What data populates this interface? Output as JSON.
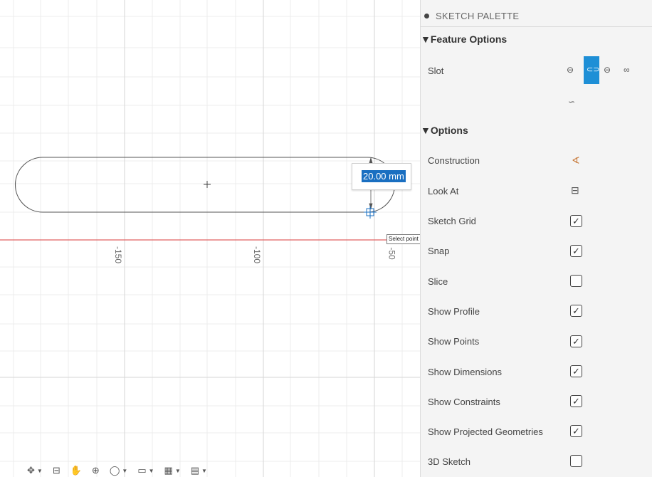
{
  "canvas": {
    "dimension_value": "20.00 mm",
    "tooltip": "Select point on slot",
    "axis_ticks": [
      "-150",
      "-100",
      "-50"
    ]
  },
  "palette": {
    "title": "SKETCH PALETTE",
    "feature_options_label": "▼Feature Options",
    "slot_label": "Slot",
    "options_label": "▼Options",
    "rows": [
      {
        "label": "Construction",
        "control": "construction-icon"
      },
      {
        "label": "Look At",
        "control": "look-at-icon"
      },
      {
        "label": "Sketch Grid",
        "checked": true
      },
      {
        "label": "Snap",
        "checked": true
      },
      {
        "label": "Slice",
        "checked": false
      },
      {
        "label": "Show Profile",
        "checked": true
      },
      {
        "label": "Show Points",
        "checked": true
      },
      {
        "label": "Show Dimensions",
        "checked": true
      },
      {
        "label": "Show Constraints",
        "checked": true
      },
      {
        "label": "Show Projected Geometries",
        "checked": true
      },
      {
        "label": "3D Sketch",
        "checked": false
      }
    ],
    "slot_types": [
      "center-to-center-slot-icon",
      "overall-slot-icon",
      "center-point-slot-icon",
      "three-point-arc-slot-icon",
      "center-point-arc-slot-icon"
    ],
    "selected_slot_type_index": 1,
    "accent_color": "#1e8fd6"
  },
  "toolbar": {
    "icons": [
      "orbit-icon",
      "look-at-icon",
      "pan-icon",
      "zoom-icon",
      "fit-icon",
      "display-settings-icon",
      "grid-settings-icon",
      "viewports-icon"
    ]
  },
  "colors": {
    "axis_red": "#e06060",
    "grid": "#e4e4e4",
    "selection_blue": "#1a6fc1"
  }
}
